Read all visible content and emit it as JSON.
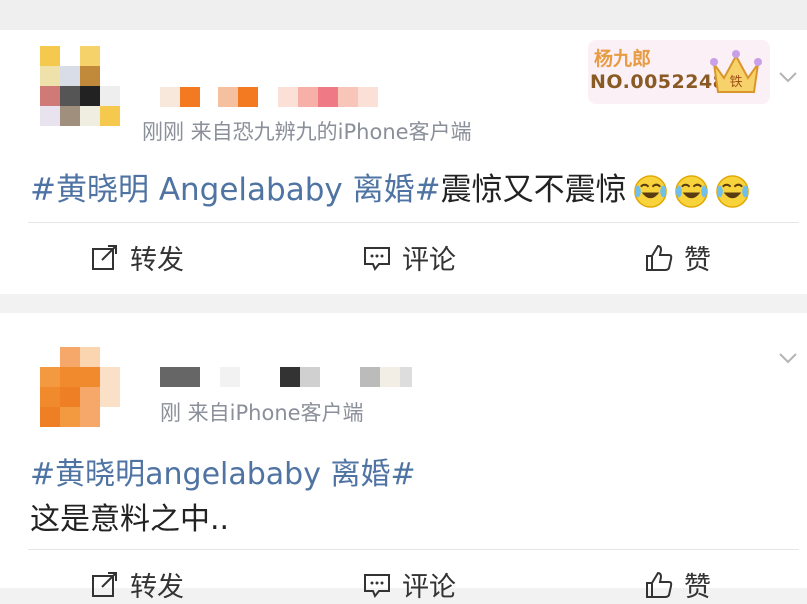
{
  "post1": {
    "meta_text": "刚刚  来自恐九辨九的iPhone客户端",
    "badge": {
      "name": "杨九郎",
      "number": "NO.0052248",
      "crown_glyph": "铁"
    },
    "topic": "#黄晓明 Angelababy 离婚#",
    "body": "震惊又不震惊",
    "emoji_name": "laugh-cry-emoji",
    "actions": {
      "repost": "转发",
      "comment": "评论",
      "like": "赞"
    }
  },
  "post2": {
    "meta_text": "刚  来自iPhone客户端",
    "topic": "#黄晓明angelababy 离婚#",
    "body": "这是意料之中..",
    "actions": {
      "repost": "转发",
      "comment": "评论",
      "like": "赞"
    }
  },
  "colors": {
    "topic": "#4f74a3",
    "meta": "#8a8f99",
    "text": "#222222",
    "badge_gold": "#e79b43"
  }
}
